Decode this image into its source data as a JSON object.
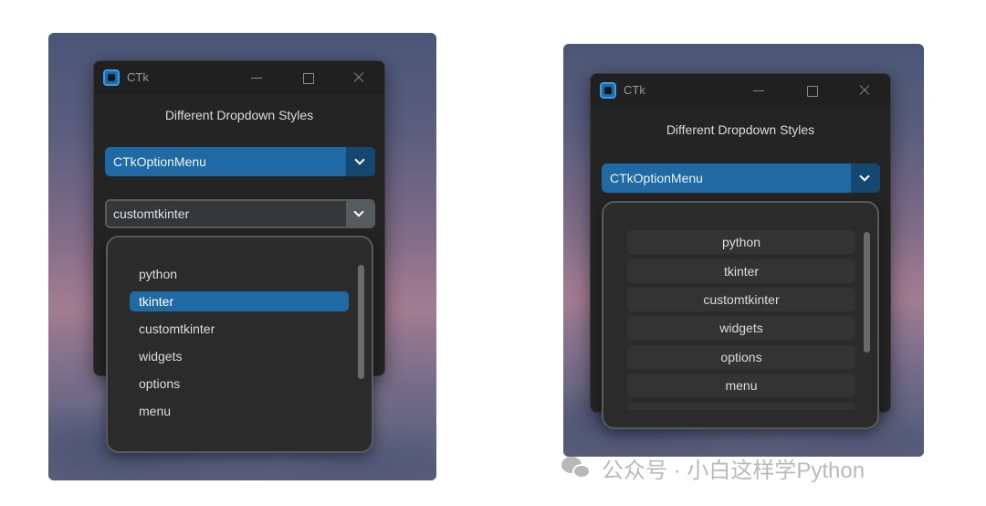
{
  "left_window": {
    "title": "CTk",
    "heading": "Different Dropdown Styles",
    "option_menu_value": "CTkOptionMenu",
    "combobox_value": "customtkinter",
    "dropdown_items": [
      "python",
      "tkinter",
      "customtkinter",
      "widgets",
      "options",
      "menu"
    ],
    "selected_item": "tkinter"
  },
  "right_window": {
    "title": "CTk",
    "heading": "Different Dropdown Styles",
    "option_menu_value": "CTkOptionMenu",
    "dropdown_items": [
      "python",
      "tkinter",
      "customtkinter",
      "widgets",
      "options",
      "menu"
    ]
  },
  "watermark": {
    "text": "公众号 · 小白这样学Python",
    "icon": "wechat-icon"
  },
  "colors": {
    "accent": "#1f6aa5",
    "accent_dark": "#144870",
    "window_bg": "#242424",
    "dropdown_bg": "#2b2b2b",
    "border": "#565b5e"
  }
}
